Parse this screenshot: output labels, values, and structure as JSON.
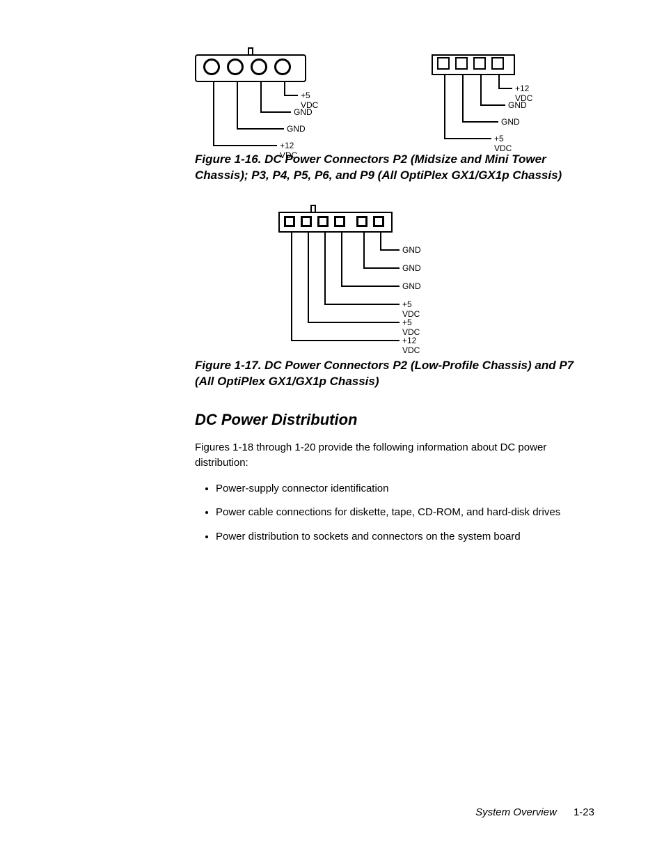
{
  "fig16": {
    "left": {
      "pins": [
        "+12 VDC",
        "GND",
        "GND",
        "+5 VDC"
      ]
    },
    "right": {
      "pins": [
        "+5 VDC",
        "GND",
        "GND",
        "+12 VDC"
      ]
    },
    "caption": "Figure 1-16.  DC Power Connectors P2 (Midsize and Mini Tower Chassis); P3, P4, P5, P6, and P9 (All OptiPlex GX1/GX1p Chassis)"
  },
  "fig17": {
    "pins": [
      "+12 VDC",
      "+5 VDC",
      "+5 VDC",
      "GND",
      "GND",
      "GND"
    ],
    "caption": "Figure 1-17.  DC Power Connectors P2 (Low-Profile Chassis) and P7 (All OptiPlex GX1/GX1p Chassis)"
  },
  "section": "DC Power Distribution",
  "para": "Figures 1-18 through 1-20 provide the following information about DC power distribution:",
  "bullets": [
    "Power-supply connector identification",
    "Power cable connections for diskette, tape, CD-ROM, and hard-disk drives",
    "Power distribution to sockets and connectors on the system board"
  ],
  "footer": {
    "title": "System Overview",
    "page": "1-23"
  }
}
